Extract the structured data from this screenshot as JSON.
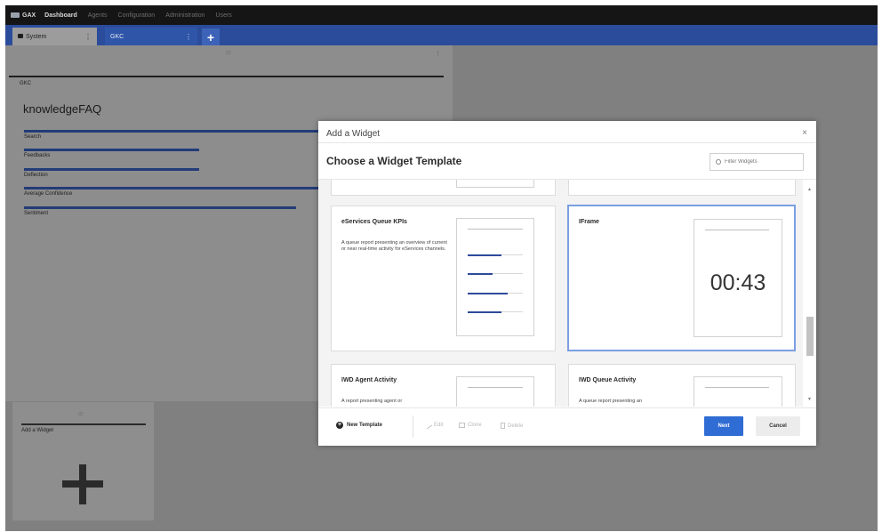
{
  "topnav": {
    "logo_text": "GAX",
    "items": [
      {
        "label": "Dashboard",
        "active": true
      },
      {
        "label": "Agents",
        "active": false
      },
      {
        "label": "Configuration",
        "active": false
      },
      {
        "label": "Administration",
        "active": false
      },
      {
        "label": "Users",
        "active": false
      }
    ]
  },
  "tabs": {
    "system_label": "System",
    "gkc_label": "GKC",
    "add_label": "+"
  },
  "left_panel": {
    "tag": "GKC",
    "title": "knowledgeFAQ",
    "metrics": [
      {
        "label": "Search",
        "value": 0.97
      },
      {
        "label": "Feedbacks",
        "value": 0.42
      },
      {
        "label": "Deflection",
        "value": 0.42
      },
      {
        "label": "Average Confidence",
        "value": 0.79
      },
      {
        "label": "Sentiment",
        "value": 0.65
      }
    ]
  },
  "add_tile": {
    "label": "Add a Widget",
    "plus": "+"
  },
  "modal": {
    "small_title": "Add a Widget",
    "close": "×",
    "title": "Choose a Widget Template",
    "filter_placeholder": "Filter Widgets",
    "cards": [
      {
        "name": "eServices Queue KPIs",
        "desc": "A queue report presenting an overview of current or near real-time activity for eServices channels."
      },
      {
        "name": "IFrame",
        "desc": "",
        "timer": "00:43"
      },
      {
        "name": "IWD Agent Activity",
        "desc": "A report presenting agent or"
      },
      {
        "name": "IWD Queue Activity",
        "desc": "A queue report presenting an"
      }
    ],
    "kpi_preview": [
      0.62,
      0.45,
      0.72,
      0.62
    ],
    "footer": {
      "new_template": "New Template",
      "edit": "Edit",
      "clone": "Clone",
      "delete": "Delete",
      "next": "Next",
      "cancel": "Cancel"
    }
  },
  "colors": {
    "topnav_bg": "#151515",
    "tabbar_bg": "#2b4c9a",
    "metric_bar": "#233b78",
    "selected_border": "#7b9ee1",
    "primary_button": "#2f6cd4"
  }
}
